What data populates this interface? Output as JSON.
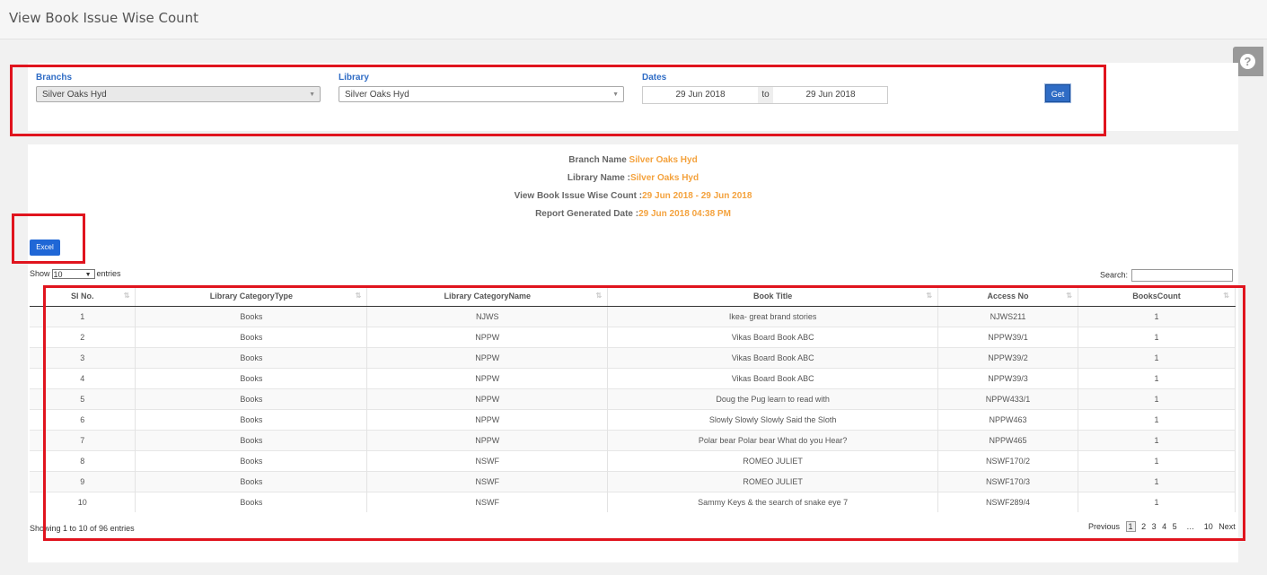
{
  "page": {
    "title": "View Book Issue Wise Count",
    "help_icon_glyph": "?"
  },
  "filters": {
    "branch_label": "Branchs",
    "branch_value": "Silver Oaks Hyd",
    "library_label": "Library",
    "library_value": "Silver Oaks Hyd",
    "dates_label": "Dates",
    "date_from": "29 Jun 2018",
    "date_to_sep": "to",
    "date_to": "29 Jun 2018",
    "get_label": "Get"
  },
  "report": {
    "branch_name_label": "Branch Name",
    "branch_name_value": "Silver Oaks Hyd",
    "library_name_label": "Library Name :",
    "library_name_value": "Silver Oaks Hyd",
    "range_label": "View Book Issue Wise Count :",
    "range_value": "29 Jun 2018 - 29 Jun 2018",
    "generated_label": "Report Generated Date :",
    "generated_value": "29 Jun 2018 04:38 PM",
    "excel_label": "Excel"
  },
  "table_controls": {
    "show_label": "Show",
    "page_length": "10",
    "entries_label": "entries",
    "search_label": "Search:"
  },
  "table": {
    "columns": [
      "Sl No.",
      "Library CategoryType",
      "Library CategoryName",
      "Book Title",
      "Access No",
      "BooksCount"
    ],
    "rows": [
      [
        "1",
        "Books",
        "NJWS",
        "Ikea- great brand stories",
        "NJWS211",
        "1"
      ],
      [
        "2",
        "Books",
        "NPPW",
        "Vikas Board Book ABC",
        "NPPW39/1",
        "1"
      ],
      [
        "3",
        "Books",
        "NPPW",
        "Vikas Board Book ABC",
        "NPPW39/2",
        "1"
      ],
      [
        "4",
        "Books",
        "NPPW",
        "Vikas Board Book ABC",
        "NPPW39/3",
        "1"
      ],
      [
        "5",
        "Books",
        "NPPW",
        "Doug the Pug learn to read with",
        "NPPW433/1",
        "1"
      ],
      [
        "6",
        "Books",
        "NPPW",
        "Slowly Slowly Slowly Said the Sloth",
        "NPPW463",
        "1"
      ],
      [
        "7",
        "Books",
        "NPPW",
        "Polar bear Polar bear What do you Hear?",
        "NPPW465",
        "1"
      ],
      [
        "8",
        "Books",
        "NSWF",
        "ROMEO JULIET",
        "NSWF170/2",
        "1"
      ],
      [
        "9",
        "Books",
        "NSWF",
        "ROMEO JULIET",
        "NSWF170/3",
        "1"
      ],
      [
        "10",
        "Books",
        "NSWF",
        "Sammy Keys & the search of snake eye 7",
        "NSWF289/4",
        "1"
      ]
    ],
    "info": "Showing 1 to 10 of 96 entries"
  },
  "pagination": {
    "previous": "Previous",
    "pages": [
      "1",
      "2",
      "3",
      "4",
      "5",
      "…",
      "10"
    ],
    "next": "Next"
  }
}
